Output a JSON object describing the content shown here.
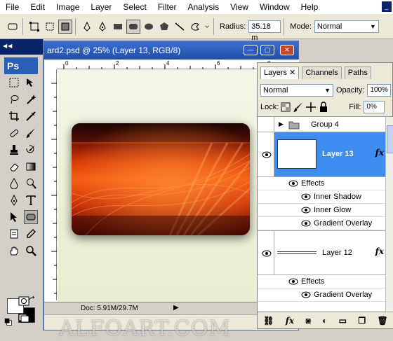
{
  "menu": [
    "File",
    "Edit",
    "Image",
    "Layer",
    "Select",
    "Filter",
    "Analysis",
    "View",
    "Window",
    "Help"
  ],
  "options_bar": {
    "radius_label": "Radius:",
    "radius_value": "35.18 m",
    "mode_label": "Mode:",
    "mode_value": "Normal"
  },
  "toolbox": {
    "logo": "Ps"
  },
  "document": {
    "title": "ard2.psd @ 25% (Layer 13, RGB/8)",
    "status": "Doc: 5.91M/29.7M",
    "ruler_ticks": [
      "0",
      "2",
      "4",
      "6",
      "8"
    ]
  },
  "watermark": "ALFOART.COM",
  "layers_panel": {
    "tabs": [
      "Layers",
      "Channels",
      "Paths"
    ],
    "blend_mode": "Normal",
    "opacity_label": "Opacity:",
    "opacity_value": "100%",
    "lock_label": "Lock:",
    "fill_label": "Fill:",
    "fill_value": "0%",
    "group_name": "Group 4",
    "layers": [
      {
        "name": "Layer 13",
        "fx": "fx"
      },
      {
        "name": "Layer 12",
        "fx": "fx"
      }
    ],
    "effects_label": "Effects",
    "layer13_effects": [
      "Inner Shadow",
      "Inner Glow",
      "Gradient Overlay"
    ],
    "layer12_effects": [
      "Gradient Overlay"
    ],
    "bottom_icons": [
      "link-icon",
      "fx-icon",
      "mask-icon",
      "adjustment-icon",
      "folder-icon",
      "new-layer-icon",
      "trash-icon"
    ]
  },
  "colors": {
    "selected_layer": "#3d8ef0",
    "title_bar": "#1f4fa8",
    "card_accent": "#f45a10"
  }
}
